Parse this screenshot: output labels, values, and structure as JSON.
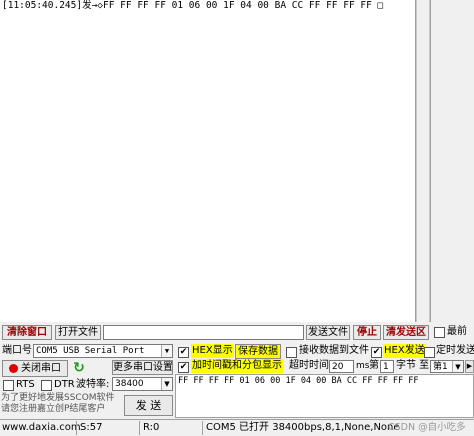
{
  "receive": {
    "log_line": "[11:05:40.245]发→◇FF FF FF FF 01 06 00 1F 04 00 BA CC FF FF FF FF □"
  },
  "toolbar": {
    "clear_window": "清除窗口",
    "open_file": "打开文件",
    "file_path": "",
    "send_file": "发送文件",
    "stop": "停止",
    "clear_send_area": "清发送区",
    "last_label": "最前"
  },
  "port": {
    "port_label": "端口号",
    "port_value": "COM5 USB Serial Port",
    "close_port": "关闭串口",
    "more_settings": "更多串口设置",
    "rts": "RTS",
    "dtr": "DTR",
    "baud_label": "波特率:",
    "baud_value": "38400",
    "promo_line1": "为了更好地发展SSCOM软件",
    "promo_line2": "请您注册嘉立创P结尾客户",
    "send_button": "发 送"
  },
  "options": {
    "hex_display": "HEX显示",
    "save_data": "保存数据",
    "receive_to_file": "接收数据到文件",
    "hex_send": "HEX发送",
    "timed_send": "定时发送",
    "timestamp": "加时间戳和分包显示",
    "timeout_label": "超时时间:",
    "timeout_value": "20",
    "ms": "ms",
    "nth_label": "第",
    "nth_value": "1",
    "byte_label": "字节 至",
    "end_value": "第1"
  },
  "send": {
    "data": "FF FF FF FF 01 06 00 1F 04 00 BA CC FF FF FF FF"
  },
  "status": {
    "website": "www.daxia.com",
    "sent": "S:57",
    "received": "R:0",
    "port_status": "COM5 已打开  38400bps,8,1,None,None",
    "watermark": "CSDN @自小吃多"
  }
}
